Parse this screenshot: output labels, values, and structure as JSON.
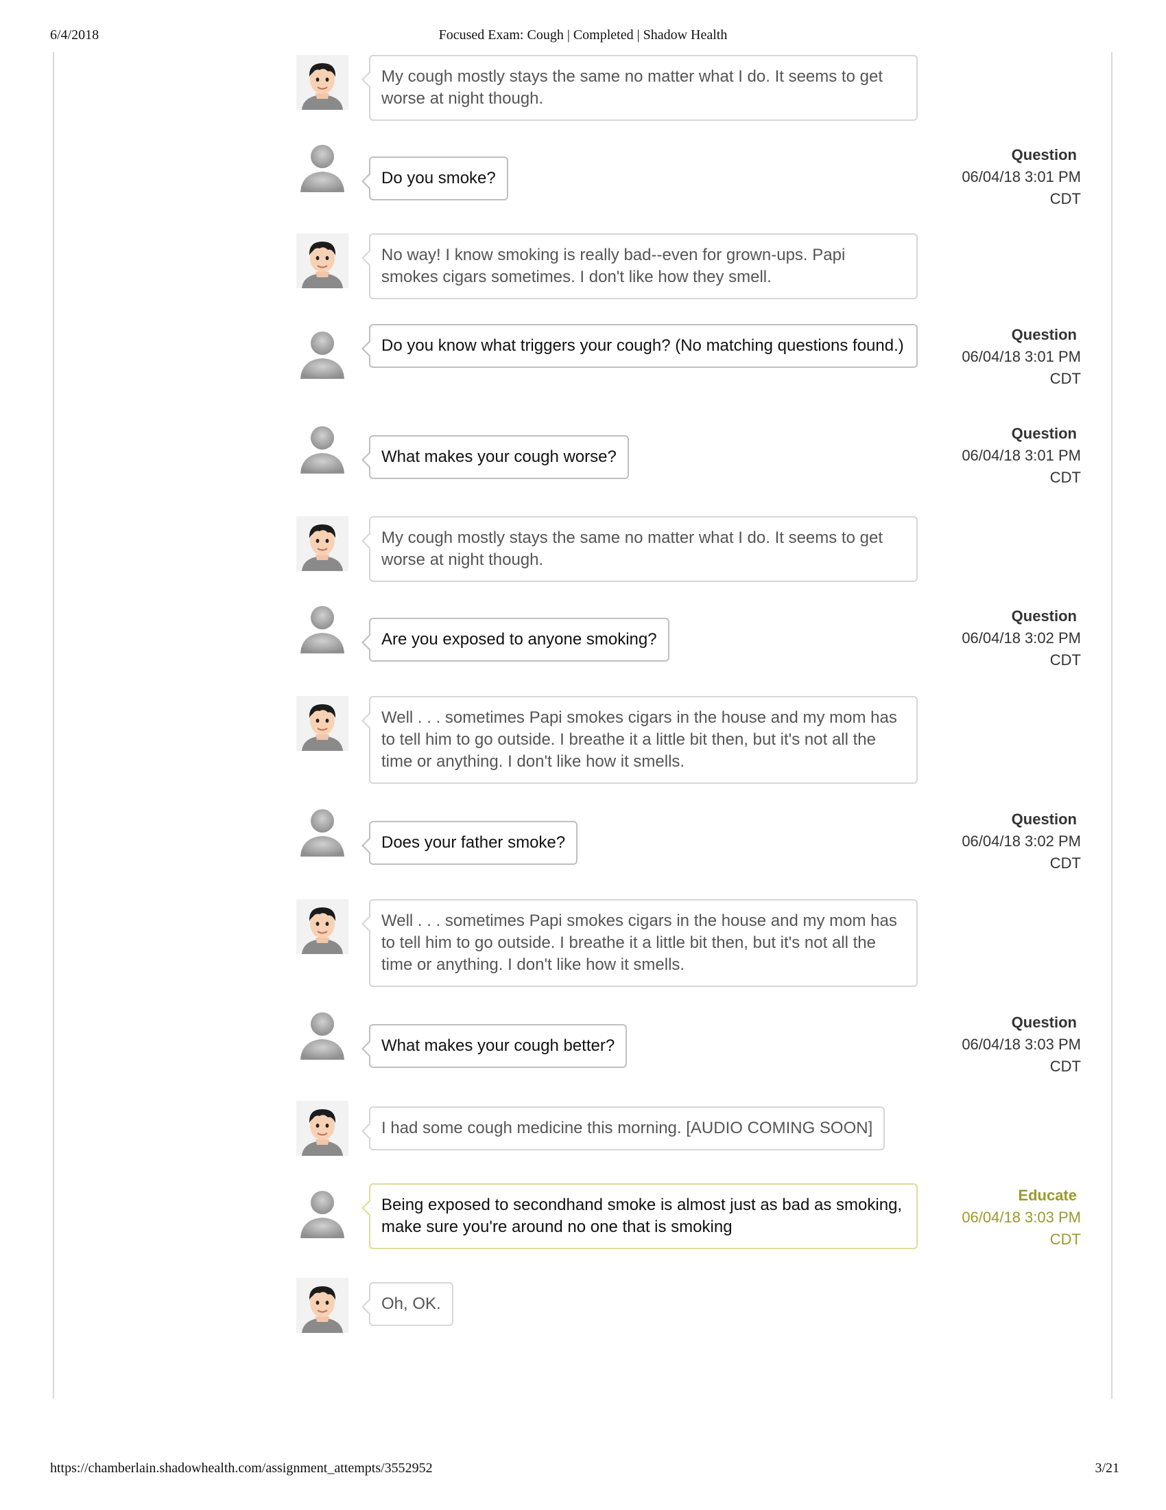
{
  "print_header": {
    "date": "6/4/2018",
    "title": "Focused Exam: Cough | Completed | Shadow Health"
  },
  "print_footer": {
    "url": "https://chamberlain.shadowhealth.com/assignment_attempts/3552952",
    "page": "3/21"
  },
  "colors": {
    "bubble_border": "#d6d6d6",
    "educate_accent": "#9a9a2a",
    "patient_text": "#555555"
  },
  "messages": [
    {
      "speaker": "patient",
      "text": "My cough mostly stays the same no matter what I do. It seems to get worse at night though."
    },
    {
      "speaker": "student",
      "text": "Do you smoke?",
      "kind": "Question",
      "date": "06/04/18 3:01 PM",
      "tz": "CDT"
    },
    {
      "speaker": "patient",
      "text": "No way! I know smoking is really bad--even for grown-ups. Papi smokes cigars sometimes. I don't like how they smell."
    },
    {
      "speaker": "student",
      "text": "Do you know what triggers your cough? (No matching questions found.)",
      "kind": "Question",
      "date": "06/04/18 3:01 PM",
      "tz": "CDT"
    },
    {
      "speaker": "student",
      "text": "What makes your cough worse?",
      "kind": "Question",
      "date": "06/04/18 3:01 PM",
      "tz": "CDT"
    },
    {
      "speaker": "patient",
      "text": "My cough mostly stays the same no matter what I do. It seems to get worse at night though."
    },
    {
      "speaker": "student",
      "text": "Are you exposed to anyone smoking?",
      "kind": "Question",
      "date": "06/04/18 3:02 PM",
      "tz": "CDT"
    },
    {
      "speaker": "patient",
      "text": "Well . . . sometimes Papi smokes cigars in the house and my mom has to tell him to go outside. I breathe it a little bit then, but it's not all the time or anything. I don't like how it smells."
    },
    {
      "speaker": "student",
      "text": "Does your father smoke?",
      "kind": "Question",
      "date": "06/04/18 3:02 PM",
      "tz": "CDT"
    },
    {
      "speaker": "patient",
      "text": "Well . . . sometimes Papi smokes cigars in the house and my mom has to tell him to go outside. I breathe it a little bit then, but it's not all the time or anything. I don't like how it smells."
    },
    {
      "speaker": "student",
      "text": "What makes your cough better?",
      "kind": "Question",
      "date": "06/04/18 3:03 PM",
      "tz": "CDT"
    },
    {
      "speaker": "patient",
      "text": "I had some cough medicine this morning. [AUDIO COMING SOON]"
    },
    {
      "speaker": "educate",
      "text": "Being exposed to secondhand smoke is almost just as bad as smoking, make sure you're around no one that is smoking",
      "kind": "Educate",
      "date": "06/04/18 3:03 PM",
      "tz": "CDT"
    },
    {
      "speaker": "patient",
      "text": "Oh, OK."
    }
  ]
}
